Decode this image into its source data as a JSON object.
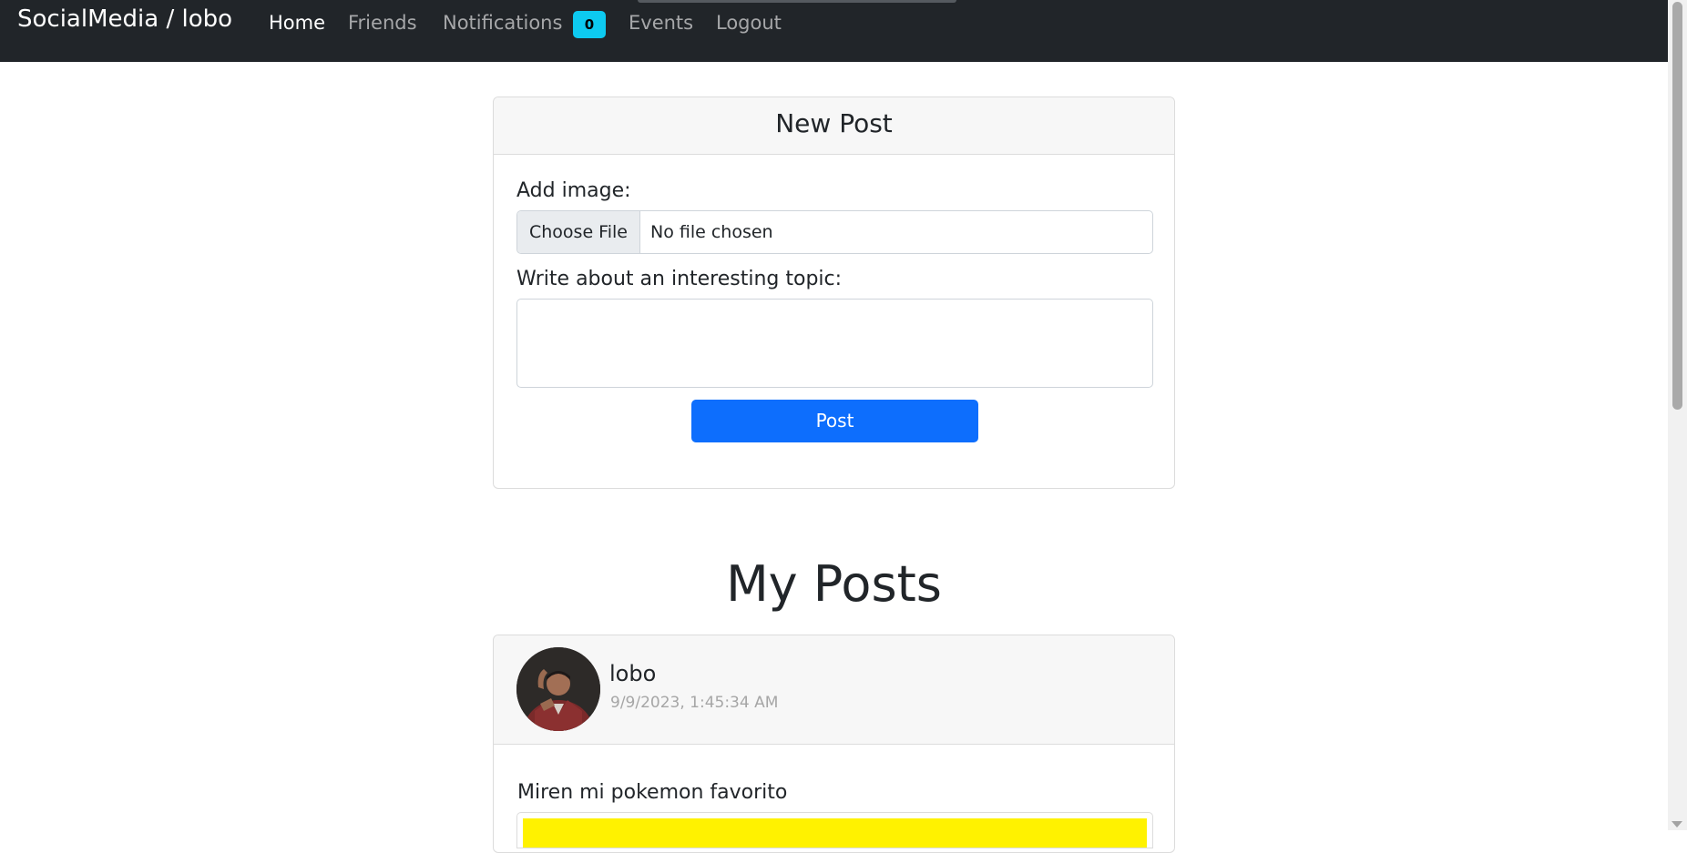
{
  "navbar": {
    "brand": "SocialMedia / lobo",
    "items": [
      {
        "label": "Home",
        "active": true
      },
      {
        "label": "Friends",
        "active": false
      },
      {
        "label": "Notifications",
        "active": false
      },
      {
        "label": "Events",
        "active": false
      },
      {
        "label": "Logout",
        "active": false
      }
    ],
    "notification_count": "0",
    "background": "#212529",
    "badge_color": "#0dcaf0"
  },
  "new_post": {
    "title": "New Post",
    "image_label": "Add image:",
    "file_button": "Choose File",
    "file_status": "No file chosen",
    "topic_label": "Write about an interesting topic:",
    "topic_value": "",
    "submit_label": "Post",
    "accent": "#0d6efd"
  },
  "my_posts": {
    "heading": "My Posts",
    "posts": [
      {
        "author": "lobo",
        "timestamp": "9/9/2023, 1:45:34 AM",
        "text": "Miren mi pokemon favorito",
        "avatar_icon": "user-avatar-photo",
        "image_color": "#fff200"
      }
    ]
  }
}
